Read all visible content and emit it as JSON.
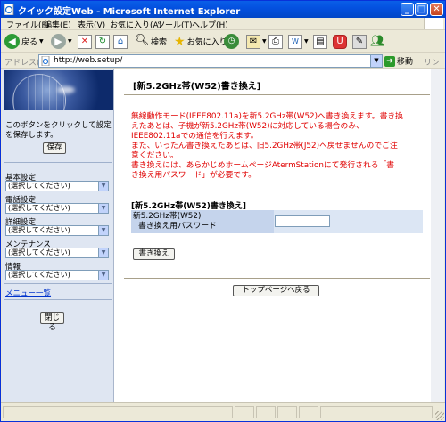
{
  "window": {
    "title": "クイック設定Web - Microsoft Internet Explorer",
    "controls": {
      "minimize": "_",
      "maximize": "□",
      "close": "✕"
    }
  },
  "menubar": {
    "items": [
      "ファイル(F)",
      "編集(E)",
      "表示(V)",
      "お気に入り(A)",
      "ツール(T)",
      "ヘルプ(H)"
    ]
  },
  "toolbar": {
    "back": "戻る",
    "search": "検索",
    "favorites": "お気に入り"
  },
  "addressbar": {
    "label": "アドレス(D)",
    "url": "http://web.setup/",
    "go": "移動",
    "links": "リンク"
  },
  "sidebar": {
    "hint": "このボタンをクリックして設定を保存します。",
    "save_label": "保存",
    "groups": [
      {
        "label": "基本設定",
        "selected": "(選択してください)"
      },
      {
        "label": "電話設定",
        "selected": "(選択してください)"
      },
      {
        "label": "詳細設定",
        "selected": "(選択してください)"
      },
      {
        "label": "メンテナンス",
        "selected": "(選択してください)"
      },
      {
        "label": "情報",
        "selected": "(選択してください)"
      }
    ],
    "menu_list_link": "メニュー一覧",
    "close_label": "閉じる"
  },
  "main": {
    "page_title": "[新5.2GHz帯(W52)書き換え]",
    "warning_lines": [
      "無線動作モード(IEEE802.11a)を新5.2GHz帯(W52)へ書き換えます。書き換",
      "えたあとは、子機が新5.2GHz帯(W52)に対応している場合のみ、",
      "IEEE802.11aでの通信を行えます。",
      "また、いったん書き換えたあとは、旧5.2GHz帯(J52)へ戻せませんのでご注",
      "意ください。",
      "書き換えには、あらかじめホームページAtermStationにて発行される「書",
      "き換え用パスワード」が必要です。"
    ],
    "section_heading": "[新5.2GHz帯(W52)書き換え]",
    "field_label_line1": "新5.2GHz帯(W52)",
    "field_label_line2": "書き換え用パスワード",
    "field_value": "",
    "rewrite_label": "書き換え",
    "top_page_label": "トップページへ戻る"
  },
  "colors": {
    "titlebar": "#0451e0",
    "warning": "#e00000",
    "sidebar_bg": "#dfe6f2",
    "table_label_bg": "#c5d4ec",
    "table_value_bg": "#dce6f4",
    "link": "#0033cc"
  },
  "icons": [
    "ie-page-icon",
    "back-arrow-icon",
    "forward-arrow-icon",
    "stop-icon",
    "refresh-icon",
    "home-icon",
    "search-icon",
    "favorites-star-icon",
    "history-icon",
    "mail-icon",
    "print-icon",
    "edit-icon",
    "messenger-icon",
    "go-arrow-icon"
  ]
}
